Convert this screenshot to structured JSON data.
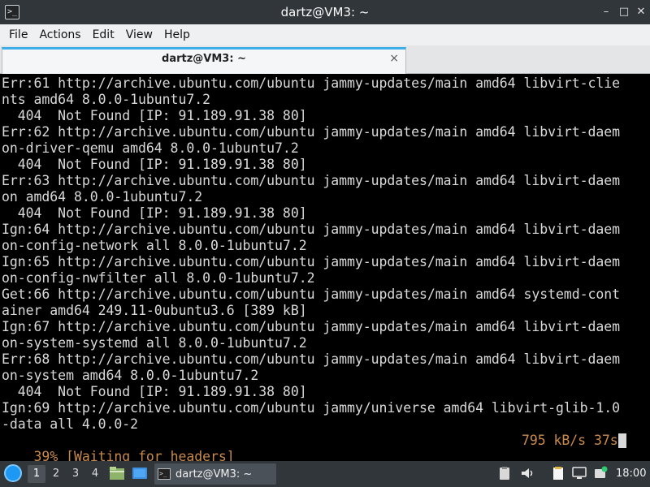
{
  "window": {
    "title": "dartz@VM3: ~",
    "controls": {
      "minimize": "–",
      "maximize": "□",
      "close": "✕"
    }
  },
  "menubar": {
    "items": [
      {
        "label": "File"
      },
      {
        "label": "Edit"
      },
      {
        "label": "View"
      },
      {
        "label": "Help"
      }
    ],
    "actions_label": "Actions"
  },
  "tab": {
    "label": "dartz@VM3: ~",
    "close": "×"
  },
  "terminal": {
    "lines": [
      "Err:61 http://archive.ubuntu.com/ubuntu jammy-updates/main amd64 libvirt-clie",
      "nts amd64 8.0.0-1ubuntu7.2",
      "  404  Not Found [IP: 91.189.91.38 80]",
      "Err:62 http://archive.ubuntu.com/ubuntu jammy-updates/main amd64 libvirt-daem",
      "on-driver-qemu amd64 8.0.0-1ubuntu7.2",
      "  404  Not Found [IP: 91.189.91.38 80]",
      "Err:63 http://archive.ubuntu.com/ubuntu jammy-updates/main amd64 libvirt-daem",
      "on amd64 8.0.0-1ubuntu7.2",
      "  404  Not Found [IP: 91.189.91.38 80]",
      "Ign:64 http://archive.ubuntu.com/ubuntu jammy-updates/main amd64 libvirt-daem",
      "on-config-network all 8.0.0-1ubuntu7.2",
      "Ign:65 http://archive.ubuntu.com/ubuntu jammy-updates/main amd64 libvirt-daem",
      "on-config-nwfilter all 8.0.0-1ubuntu7.2",
      "Get:66 http://archive.ubuntu.com/ubuntu jammy-updates/main amd64 systemd-cont",
      "ainer amd64 249.11-0ubuntu3.6 [389 kB]",
      "Ign:67 http://archive.ubuntu.com/ubuntu jammy-updates/main amd64 libvirt-daem",
      "on-system-systemd all 8.0.0-1ubuntu7.2",
      "Err:68 http://archive.ubuntu.com/ubuntu jammy-updates/main amd64 libvirt-daem",
      "on-system amd64 8.0.0-1ubuntu7.2",
      "  404  Not Found [IP: 91.189.91.38 80]",
      "Ign:69 http://archive.ubuntu.com/ubuntu jammy/universe amd64 libvirt-glib-1.0",
      "-data all 4.0.0-2"
    ],
    "status_left": "39% [Waiting for headers]",
    "status_right": "795 kB/s 37s"
  },
  "taskbar": {
    "workspaces": [
      "1",
      "2",
      "3",
      "4"
    ],
    "task_label": "dartz@VM3: ~",
    "clock": "18:00"
  },
  "colors": {
    "titlebar": "#31363b",
    "terminal_bg": "#000000",
    "terminal_fg": "#d9d9d9",
    "status_fg": "#c98a4b",
    "accent": "#3daee9"
  }
}
